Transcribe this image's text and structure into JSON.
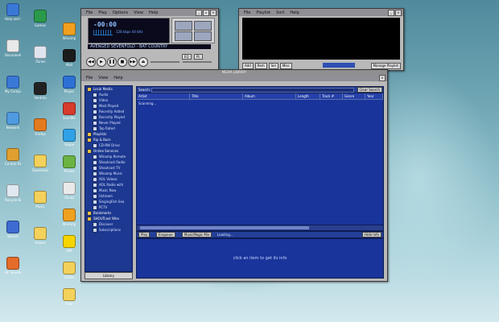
{
  "desktop": {
    "icons": [
      {
        "label": "Help and Support",
        "color": "#3a78d8"
      },
      {
        "label": "Documents",
        "color": "#e9e9e9"
      },
      {
        "label": "My Computer",
        "color": "#3a78d8"
      },
      {
        "label": "Network",
        "color": "#4f9ae0"
      },
      {
        "label": "Control Panel",
        "color": "#e0a030"
      },
      {
        "label": "Recycle Bin",
        "color": "#dfe8ef"
      },
      {
        "label": "Search",
        "color": "#3d6cd1"
      },
      {
        "label": "HF Sounds",
        "color": "#e46b2a"
      },
      {
        "label": "Games",
        "color": "#2a9a4a"
      },
      {
        "label": "iTunes",
        "color": "#dfe4ee"
      },
      {
        "label": "Ventrilo",
        "color": "#222"
      },
      {
        "label": "Firefox",
        "color": "#e47a1f"
      },
      {
        "label": "Downloads",
        "color": "#f3d15a"
      },
      {
        "label": "Music",
        "color": "#f3d15a"
      },
      {
        "label": "Videos",
        "color": "#f3d15a"
      }
    ],
    "row2_icons": [
      {
        "label": "Winamp",
        "color": "#f0a020"
      },
      {
        "label": "Mail",
        "color": "#1b1b1b"
      },
      {
        "label": "Player",
        "color": "#2c70d6"
      },
      {
        "label": "ScanMe",
        "color": "#d63b2c"
      },
      {
        "label": "Skype",
        "color": "#2fa1e6"
      },
      {
        "label": "Picasa",
        "color": "#6bb342"
      },
      {
        "label": "iTunes",
        "color": "#e9e9e9"
      },
      {
        "label": "WinAmp",
        "color": "#f0a020"
      },
      {
        "label": "AIM",
        "color": "#f6d400"
      },
      {
        "label": "Folder",
        "color": "#f3d15a"
      },
      {
        "label": "Files",
        "color": "#f3d15a"
      }
    ]
  },
  "player": {
    "menu": [
      "File",
      "Play",
      "Options",
      "View",
      "Help"
    ],
    "time": "-00:00",
    "kbps": "128 kbps",
    "khz": "44 kHz",
    "scroll_text": "AVENGED SEVENFOLD - BAT COUNTRY",
    "eq_label": "EQ",
    "pl_label": "PL",
    "controls": [
      "◀◀",
      "▶",
      "❚❚",
      "■",
      "▶▶",
      "⏏"
    ]
  },
  "playlist": {
    "menu": [
      "File",
      "Playlist",
      "Sort",
      "Help"
    ],
    "buttons": [
      "Add",
      "Rem",
      "Sel",
      "Misc"
    ],
    "manage": "Manage Playlist"
  },
  "library": {
    "title": "MEDIA LIBRARY",
    "menu": [
      "File",
      "View",
      "Help"
    ],
    "tree": [
      {
        "label": "Local Media",
        "level": 0
      },
      {
        "label": "Audio",
        "level": 1
      },
      {
        "label": "Video",
        "level": 1
      },
      {
        "label": "Most Played",
        "level": 1
      },
      {
        "label": "Recently Added",
        "level": 1
      },
      {
        "label": "Recently Played",
        "level": 1
      },
      {
        "label": "Never Played",
        "level": 1
      },
      {
        "label": "Top Rated",
        "level": 1
      },
      {
        "label": "Playlists",
        "level": 0
      },
      {
        "label": "Rip & Burn",
        "level": 0
      },
      {
        "label": "CD-RW Drive",
        "level": 1
      },
      {
        "label": "Online Services",
        "level": 0
      },
      {
        "label": "Winamp Remote",
        "level": 1
      },
      {
        "label": "Shoutcast Radio",
        "level": 1
      },
      {
        "label": "Shoutcast TV",
        "level": 1
      },
      {
        "label": "Winamp Music",
        "level": 1
      },
      {
        "label": "AOL Videos",
        "level": 1
      },
      {
        "label": "AOL Radio with",
        "level": 1
      },
      {
        "label": "Music Now",
        "level": 1
      },
      {
        "label": "Ustream",
        "level": 1
      },
      {
        "label": "SingingFish Sea",
        "level": 1
      },
      {
        "label": "PCTV",
        "level": 1
      },
      {
        "label": "Bookmarks",
        "level": 0
      },
      {
        "label": "SHOUTcast Wire",
        "level": 0
      },
      {
        "label": "Discover",
        "level": 1
      },
      {
        "label": "Subscriptions",
        "level": 1
      }
    ],
    "library_button": "Library",
    "search_label": "Search:",
    "clear_search": "Clear Search",
    "columns": [
      "Artist",
      "Title",
      "Album",
      "Length",
      "Track #",
      "Genre",
      "Year"
    ],
    "status": "Scanning...",
    "play_button": "Play",
    "enqueue_button": "Enqueue",
    "mix_button": "MusicMagic Mix",
    "play_status": "Loading...",
    "hide_info": "Hide Info",
    "info_message": "click an item to get its info"
  }
}
